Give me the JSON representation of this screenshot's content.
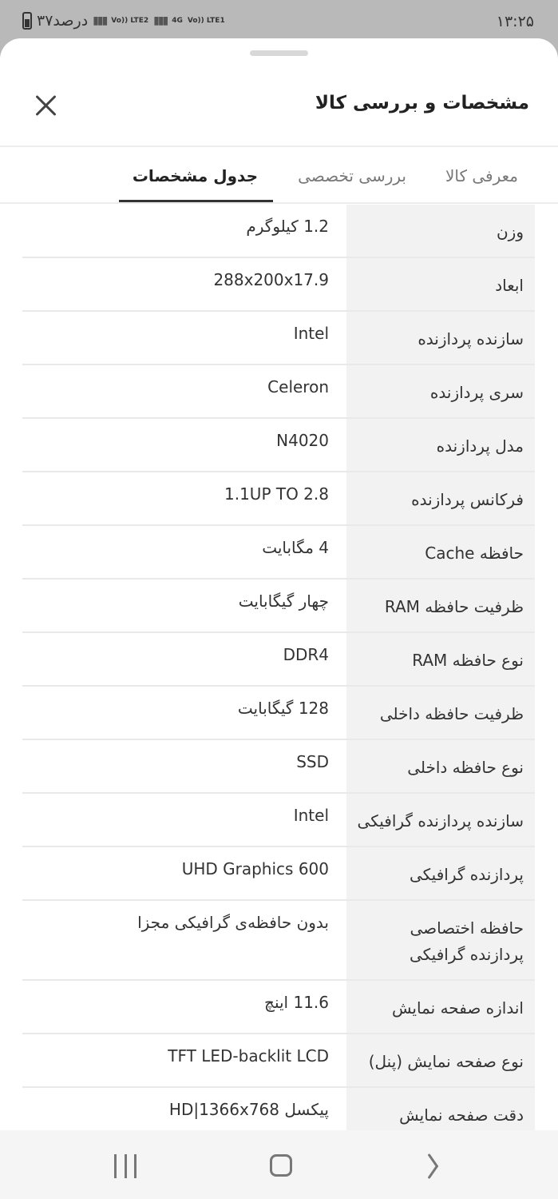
{
  "status": {
    "time": "۱۳:۲۵",
    "battery": "۳۷درصد",
    "sim2": "Vo)) LTE2",
    "sim1_type": "4G",
    "sim1": "Vo)) LTE1"
  },
  "header": {
    "title": "مشخصات و بررسی کالا"
  },
  "tabs": [
    {
      "label": "معرفی کالا"
    },
    {
      "label": "بررسی تخصصی"
    },
    {
      "label": "جدول مشخصات"
    }
  ],
  "specs": [
    {
      "key": "وزن",
      "value": "1.2 کیلوگرم"
    },
    {
      "key": "ابعاد",
      "value": "288x200x17.9"
    },
    {
      "key": "سازنده پردازنده",
      "value": "Intel"
    },
    {
      "key": "سری پردازنده",
      "value": "Celeron"
    },
    {
      "key": "مدل پردازنده",
      "value": "N4020"
    },
    {
      "key": "فرکانس پردازنده",
      "value": "1.1UP TO 2.8"
    },
    {
      "key": "حافظه Cache",
      "value": "4 مگابایت"
    },
    {
      "key": "ظرفیت حافظه RAM",
      "value": "چهار گیگابایت"
    },
    {
      "key": "نوع حافظه RAM",
      "value": "DDR4"
    },
    {
      "key": "ظرفیت حافظه داخلی",
      "value": "128 گیگابایت"
    },
    {
      "key": "نوع حافظه داخلی",
      "value": "SSD"
    },
    {
      "key": "سازنده پردازنده گرافیکی",
      "value": "Intel"
    },
    {
      "key": "پردازنده گرافیکی",
      "value": "UHD Graphics 600"
    },
    {
      "key": "حافظه اختصاصی پردازنده گرافیکی",
      "value": "بدون حافظه‌ی گرافیکی مجزا"
    },
    {
      "key": "اندازه صفحه نمایش",
      "value": "11.6 اینچ"
    },
    {
      "key": "نوع صفحه نمایش (پنل)",
      "value": "TFT LED-backlit LCD"
    },
    {
      "key": "دقت صفحه نمایش",
      "value": "پیکسل HD|1366x768"
    }
  ]
}
